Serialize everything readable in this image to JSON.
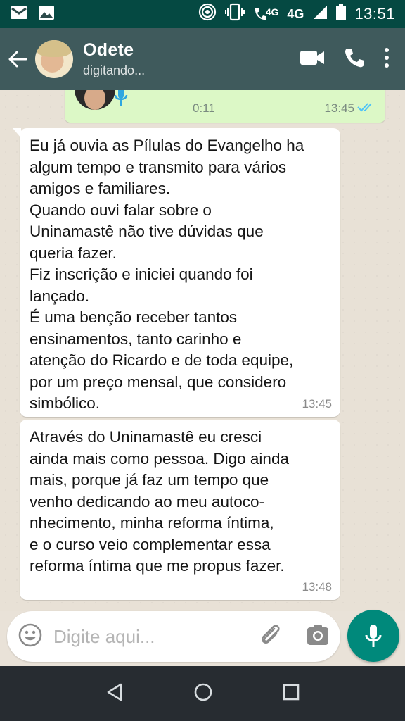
{
  "status_bar": {
    "network_small": "4G",
    "network_large": "4G",
    "time": "13:51"
  },
  "header": {
    "contact_name": "Odete",
    "contact_status": "digitando..."
  },
  "voice_message": {
    "duration": "0:11",
    "time": "13:45",
    "tick_color": "#4fc3f7"
  },
  "messages": [
    {
      "text": "Eu já ouvia as Pílulas do Evangelho ha\nalgum tempo e transmito para vários\namigos e familiares.\nQuando ouvi falar sobre o\nUninamastê não tive dúvidas que\nqueria fazer.\nFiz inscrição e iniciei quando foi\nlançado.\nÉ uma benção receber tantos\nensinamentos, tanto carinho e\natenção do Ricardo e de toda equipe,\npor um preço mensal, que considero\nsimbólico.",
      "time": "13:45"
    },
    {
      "text": "Através do Uninamastê eu cresci\nainda mais como pessoa. Digo ainda\nmais, porque já faz um tempo que\nvenho dedicando ao meu autoco-\nnhecimento, minha reforma íntima,\ne o curso veio complementar essa\nreforma íntima que me propus fazer.",
      "time": "13:48"
    }
  ],
  "composer": {
    "placeholder": "Digite aqui..."
  },
  "colors": {
    "header": "#3f5a5c",
    "outgoing_bubble": "#dcf8c6",
    "incoming_bubble": "#ffffff",
    "accent": "#00897b"
  },
  "icons": {
    "status_left": [
      "gmail-icon",
      "gallery-icon"
    ],
    "status_right": [
      "hotspot-icon",
      "vibrate-icon",
      "call-4g-icon",
      "signal-icon",
      "battery-icon"
    ],
    "header": [
      "back-arrow-icon",
      "video-call-icon",
      "phone-icon",
      "more-options-icon"
    ],
    "composer": [
      "emoji-icon",
      "attach-icon",
      "camera-icon",
      "mic-icon"
    ],
    "nav": [
      "nav-back-icon",
      "nav-home-icon",
      "nav-recents-icon"
    ]
  }
}
